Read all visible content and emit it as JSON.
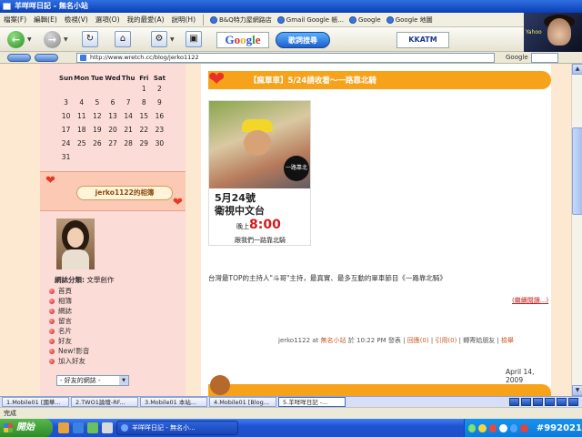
{
  "window": {
    "title": "羊咩咩日記 - 無名小站"
  },
  "menu": [
    "檔案(F)",
    "編輯(E)",
    "檢視(V)",
    "選項(O)",
    "我的最愛(A)",
    "說明(H)"
  ],
  "favorites": [
    "B&Q特力屋網路店",
    "Gmail Google 帳...",
    "Google",
    "Google 地圖"
  ],
  "toolbar": {
    "google": "Google",
    "search_button": "歌詞搜尋",
    "kkatm": "KKATM"
  },
  "avatar_label": "Yahoo",
  "address": {
    "url": "http://www.wretch.cc/blog/jerko1122",
    "google_label": "Google"
  },
  "calendar": {
    "days": [
      "Sun",
      "Mon",
      "Tue",
      "Wed",
      "Thu",
      "Fri",
      "Sat"
    ],
    "dates": [
      "",
      "",
      "",
      "",
      "",
      "1",
      "2",
      "3",
      "4",
      "5",
      "6",
      "7",
      "8",
      "9",
      "10",
      "11",
      "12",
      "13",
      "14",
      "15",
      "16",
      "17",
      "18",
      "19",
      "20",
      "21",
      "22",
      "23",
      "24",
      "25",
      "26",
      "27",
      "28",
      "29",
      "30",
      "31",
      "",
      "",
      "",
      "",
      "",
      ""
    ]
  },
  "sidebar": {
    "album_title": "jerko1122的相簿",
    "category_label": "網誌分類:",
    "category_value": "文學創作",
    "nav": [
      "首頁",
      "相簿",
      "網誌",
      "留言",
      "名片",
      "好友",
      "New!影音",
      "加入好友"
    ],
    "friends_select": "- 好友的網誌 -"
  },
  "post": {
    "title": "【瘋單車】5/24請收看～一路靠北騎",
    "poster": {
      "stamp": "一路靠北騎",
      "date": "5月24號",
      "channel": "衛視中文台",
      "time_prefix": "晚上",
      "time": "8:00",
      "tag": "跟我們一路靠北騎"
    },
    "description": "台灣最TOP的主持人\"斗哥\"主持，最真實、最多互動的單車節目《一路靠北騎》",
    "read_more": "(繼續閱讀...)",
    "meta": {
      "author": "jerko1122 at",
      "site": "無名小站",
      "time": "於 10:22 PM 發表 |",
      "reply": "回應(0)",
      "sep1": "|",
      "trackback": "引用(0)",
      "sep2": "|",
      "forward": "轉寄給朋友",
      "sep3": "|",
      "report": "檢舉"
    },
    "date": "April 14, 2009"
  },
  "ie_tabs": [
    "1.Mobile01 [國華...",
    "2.TWO1論壇-RF...",
    "3.Mobile01 本站...",
    "4.Mobile01 [Blog...",
    "5.羊咩咩日記 -..."
  ],
  "status": {
    "text": "完成"
  },
  "taskbar": {
    "start": "開始",
    "task": "羊咩咩日記 - 無名小...",
    "tray_text": "#992021"
  }
}
